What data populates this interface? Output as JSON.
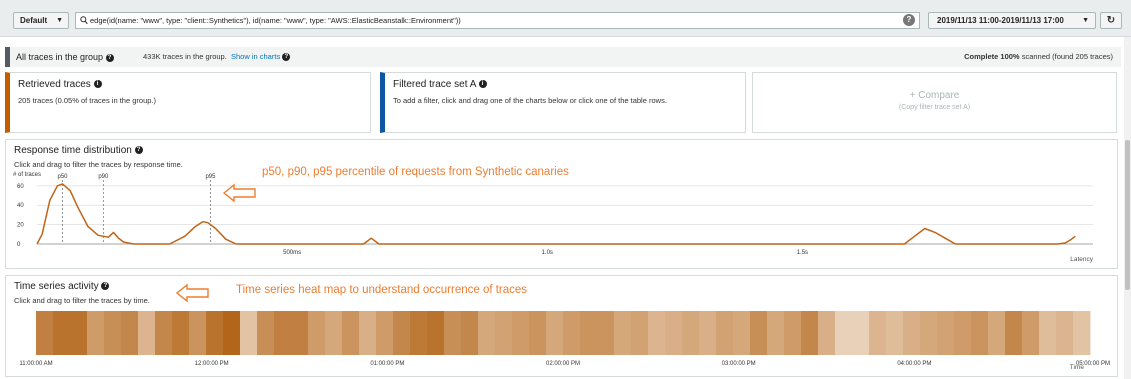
{
  "toolbar": {
    "group_label": "Default",
    "query": "edge(id(name: \"www\", type: \"client::Synthetics\"), id(name: \"www\", type: \"AWS::ElasticBeanstalk::Environment\"))",
    "date_range": "2019/11/13 11:00-2019/11/13 17:00",
    "help_icon": "question-circle-icon",
    "refresh_icon": "refresh-icon"
  },
  "group_row": {
    "title": "All traces in the group",
    "count_text": "433K traces in the group.",
    "show_charts": "Show in charts",
    "scan_prefix": "Complete",
    "scan_percent": "100%",
    "scan_suffix": "scanned (found 205 traces)"
  },
  "cards": {
    "retrieved": {
      "title": "Retrieved traces",
      "subtitle": "205 traces (0.05% of traces in the group.)",
      "accent": "#c45d00"
    },
    "filtered": {
      "title": "Filtered trace set A",
      "subtitle": "To add a filter, click and drag one of the charts below or click one of the table rows.",
      "accent": "#0b57a4"
    },
    "compare": {
      "label": "+ Compare",
      "subtitle": "(Copy filter trace set A)"
    }
  },
  "response_time": {
    "title": "Response time distribution",
    "hint": "Click and drag to filter the traces by response time.",
    "annotation": "p50, p90, p95 percentile of requests from Synthetic canaries"
  },
  "time_series": {
    "title": "Time series activity",
    "hint": "Click and drag to filter the traces by time.",
    "annotation": "Time series heat map to understand occurrence of traces"
  },
  "chart_data": [
    {
      "type": "line",
      "ylabel": "# of traces",
      "xlabel": "Latency",
      "y_ticks": [
        "0",
        "20",
        "40",
        "60"
      ],
      "y_tick_values": [
        0,
        20,
        40,
        60
      ],
      "ylim": [
        0,
        65
      ],
      "x_tick_labels": [
        "500ms",
        "1.0s",
        "1.5s"
      ],
      "x_tick_values": [
        0.5,
        1.0,
        1.5
      ],
      "xlim": [
        0,
        2.05
      ],
      "percentiles": [
        {
          "label": "p50",
          "value": 0.05
        },
        {
          "label": "p90",
          "value": 0.13
        },
        {
          "label": "p95",
          "value": 0.34
        }
      ],
      "x": [
        0,
        0.01,
        0.025,
        0.04,
        0.05,
        0.065,
        0.08,
        0.1,
        0.12,
        0.14,
        0.15,
        0.16,
        0.17,
        0.19,
        0.22,
        0.26,
        0.29,
        0.31,
        0.325,
        0.335,
        0.35,
        0.37,
        0.39,
        0.42,
        0.6,
        0.64,
        0.655,
        0.67,
        0.7,
        1.5,
        1.7,
        1.72,
        1.74,
        1.76,
        1.78,
        1.8,
        2.0,
        2.015,
        2.025,
        2.035
      ],
      "values": [
        0,
        10,
        45,
        60,
        62,
        55,
        38,
        18,
        9,
        7,
        12,
        6,
        2,
        0,
        0,
        0,
        8,
        18,
        23,
        22,
        16,
        5,
        0,
        0,
        0,
        0,
        6,
        0,
        0,
        0,
        0,
        8,
        16,
        12,
        6,
        0,
        0,
        1,
        4,
        8
      ]
    },
    {
      "type": "heatmap",
      "xlabel": "Time",
      "x_tick_labels": [
        "11:00:00 AM",
        "12:00:00 PM",
        "01:00:00 PM",
        "02:00:00 PM",
        "03:00:00 PM",
        "04:00:00 PM",
        "05:00:00 PM"
      ],
      "x_tick_hours": [
        11,
        12,
        13,
        14,
        15,
        16,
        17
      ],
      "time_range_hours": [
        11,
        17
      ],
      "intensity": [
        0.75,
        0.85,
        0.85,
        0.55,
        0.65,
        0.7,
        0.35,
        0.7,
        0.8,
        0.6,
        0.85,
        0.95,
        0.25,
        0.65,
        0.75,
        0.75,
        0.55,
        0.45,
        0.6,
        0.4,
        0.55,
        0.7,
        0.8,
        0.85,
        0.65,
        0.7,
        0.45,
        0.5,
        0.55,
        0.6,
        0.45,
        0.55,
        0.6,
        0.6,
        0.45,
        0.5,
        0.35,
        0.4,
        0.45,
        0.4,
        0.5,
        0.45,
        0.65,
        0.45,
        0.55,
        0.7,
        0.4,
        0.15,
        0.15,
        0.35,
        0.3,
        0.4,
        0.45,
        0.5,
        0.55,
        0.6,
        0.45,
        0.7,
        0.55,
        0.3,
        0.35,
        0.25
      ],
      "color_dark": "#b05f0f",
      "color_light": "#f3e4d6"
    }
  ]
}
